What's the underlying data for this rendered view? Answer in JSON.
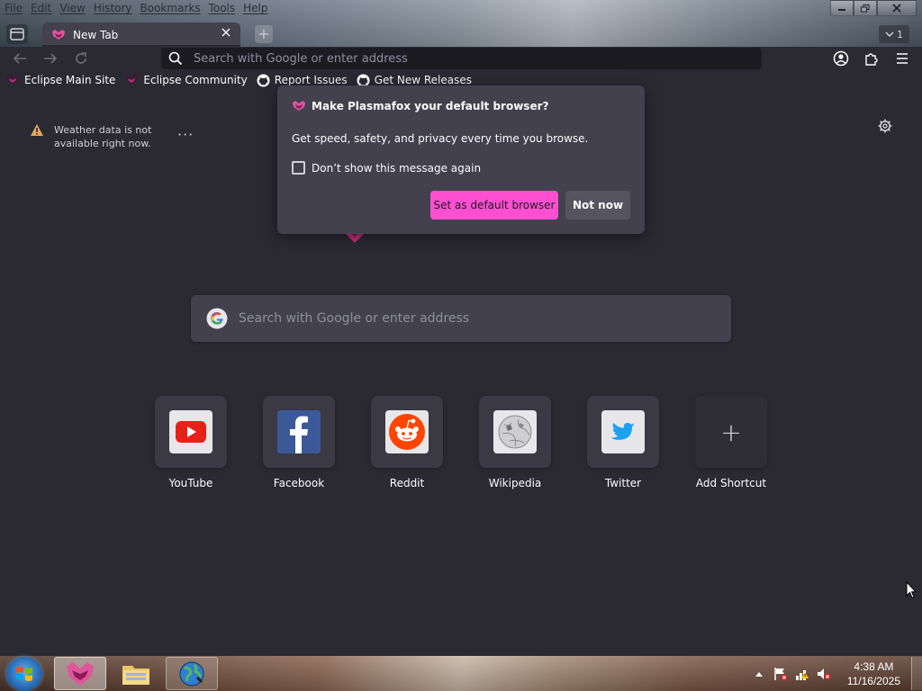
{
  "menubar": {
    "items": [
      "File",
      "Edit",
      "View",
      "History",
      "Bookmarks",
      "Tools",
      "Help"
    ]
  },
  "tabs": {
    "active_title": "New Tab",
    "count_badge": "1"
  },
  "navbar": {
    "url_placeholder": "Search with Google or enter address"
  },
  "bookmarks": [
    {
      "label": "Eclipse Main Site",
      "icon": "plasmafox-icon"
    },
    {
      "label": "Eclipse Community",
      "icon": "plasmafox-icon"
    },
    {
      "label": "Report Issues",
      "icon": "github-icon"
    },
    {
      "label": "Get New Releases",
      "icon": "github-icon"
    }
  ],
  "weather": {
    "message": "Weather data is not available right now."
  },
  "search": {
    "placeholder": "Search with Google or enter address"
  },
  "shortcuts": [
    {
      "label": "YouTube",
      "icon": "youtube-icon"
    },
    {
      "label": "Facebook",
      "icon": "facebook-icon"
    },
    {
      "label": "Reddit",
      "icon": "reddit-icon"
    },
    {
      "label": "Wikipedia",
      "icon": "wikipedia-icon"
    },
    {
      "label": "Twitter",
      "icon": "twitter-icon"
    },
    {
      "label": "Add Shortcut",
      "icon": "plus-icon"
    }
  ],
  "dialog": {
    "title": "Make Plasmafox your default browser?",
    "message": "Get speed, safety, and privacy every time you browse.",
    "checkbox_label": "Don’t show this message again",
    "primary_button": "Set as default browser",
    "secondary_button": "Not now"
  },
  "taskbar": {
    "time": "4:38 AM",
    "date": "11/16/2025"
  },
  "colors": {
    "accent": "#ff4fd1",
    "page_bg": "#2b2a33",
    "dialog_bg": "#42414d"
  }
}
